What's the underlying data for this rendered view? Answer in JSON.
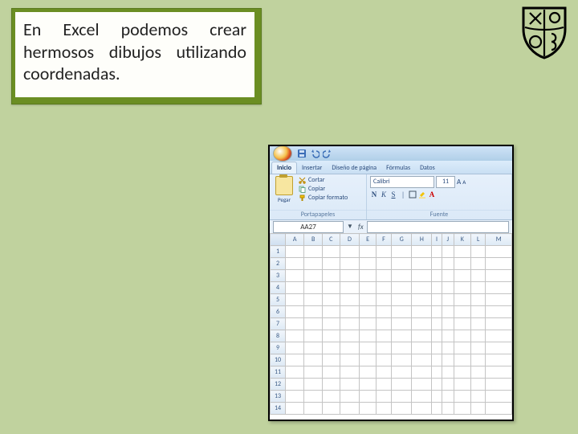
{
  "caption": "En Excel podemos crear hermosos dibujos utilizando coordenadas.",
  "excel": {
    "tabs": [
      "Inicio",
      "Insertar",
      "Diseño de página",
      "Fórmulas",
      "Datos"
    ],
    "active_tab": 0,
    "clipboard": {
      "paste": "Pegar",
      "cut": "Cortar",
      "copy": "Copiar",
      "format_painter": "Copiar formato",
      "group_label": "Portapapeles"
    },
    "font": {
      "name": "Calibri",
      "size": "11",
      "group_label": "Fuente",
      "bold": "N",
      "italic": "K",
      "underline": "S"
    },
    "namebox": "AA27",
    "columns": [
      "A",
      "B",
      "C",
      "D",
      "E",
      "F",
      "G",
      "H",
      "I",
      "J",
      "K",
      "L",
      "M"
    ],
    "rows": [
      "1",
      "2",
      "3",
      "4",
      "5",
      "6",
      "7",
      "8",
      "9",
      "10",
      "11",
      "12",
      "13",
      "14"
    ]
  }
}
